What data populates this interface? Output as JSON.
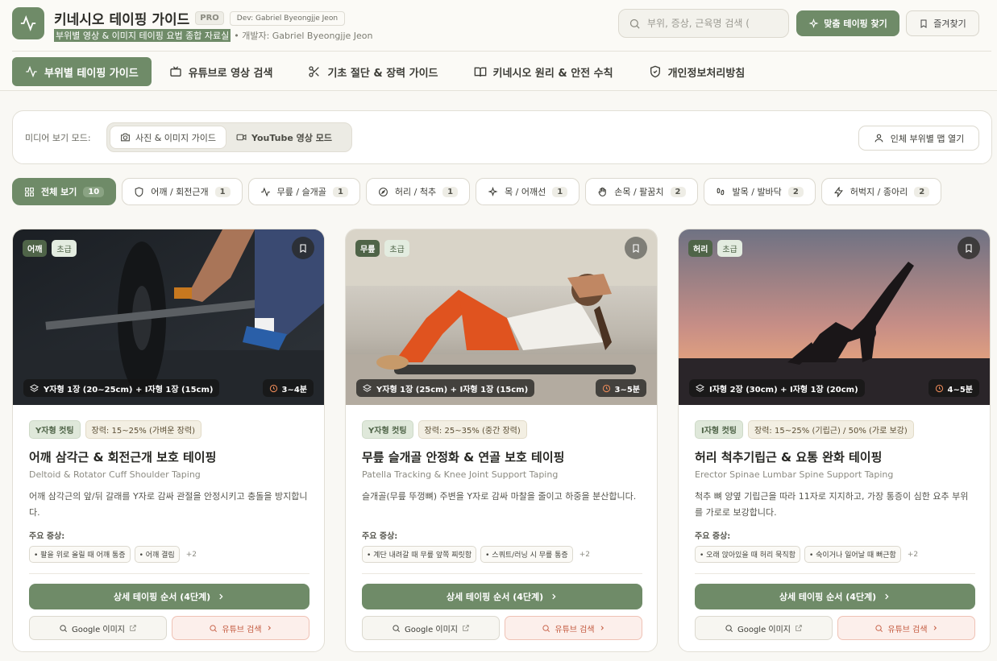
{
  "header": {
    "title": "키네시오 테이핑 가이드",
    "pro_badge": "PRO",
    "dev_badge": "Dev: Gabriel Byeongjje Jeon",
    "subtitle": "부위별 영상 & 이미지 테이핑 요법 종합 자료실",
    "subtitle_dev": "• 개발자: Gabriel Byeongjje Jeon",
    "search_placeholder": "부위, 증상, 근육명 검색 (",
    "find_button": "맞춤 테이핑 찾기",
    "fav_button": "즐겨찾기"
  },
  "nav": {
    "items": [
      {
        "label": "부위별 테이핑 가이드",
        "icon": "activity-icon"
      },
      {
        "label": "유튜브로 영상 검색",
        "icon": "tv-icon"
      },
      {
        "label": "기초 절단 & 장력 가이드",
        "icon": "scissors-icon"
      },
      {
        "label": "키네시오 원리 & 안전 수칙",
        "icon": "book-icon"
      },
      {
        "label": "개인정보처리방침",
        "icon": "shield-icon"
      }
    ]
  },
  "media": {
    "label": "미디어 보기 모드:",
    "photo_mode": "사진 & 이미지 가이드",
    "video_mode": "YouTube 영상 모드",
    "map_button": "인체 부위별 맵 열기"
  },
  "filters": [
    {
      "label": "전체 보기",
      "count": "10"
    },
    {
      "label": "어깨 / 회전근개",
      "count": "1"
    },
    {
      "label": "무릎 / 슬개골",
      "count": "1"
    },
    {
      "label": "허리 / 척추",
      "count": "1"
    },
    {
      "label": "목 / 어깨선",
      "count": "1"
    },
    {
      "label": "손목 / 팔꿈치",
      "count": "2"
    },
    {
      "label": "발목 / 발바닥",
      "count": "2"
    },
    {
      "label": "허벅지 / 종아리",
      "count": "2"
    }
  ],
  "cards": [
    {
      "area": "어깨",
      "level": "초급",
      "spec": "Y자형 1장 (20~25cm) + I자형 1장 (15cm)",
      "time": "3~4분",
      "cut": "Y자형 컷팅",
      "tension": "장력: 15~25% (가벼운 장력)",
      "title": "어깨 삼각근 & 회전근개 보호 테이핑",
      "title_en": "Deltoid & Rotator Cuff Shoulder Taping",
      "desc": "어깨 삼각근의 앞/뒤 갈래를 Y자로 감싸 관절을 안정시키고 충돌을 방지합니다.",
      "symptoms_label": "주요 증상:",
      "symptoms": [
        "• 팔을 위로 올릴 때 어깨 통증",
        "• 어깨 결림"
      ],
      "more": "+2",
      "detail_button": "상세 테이핑 순서 (4단계)",
      "google_button": "Google 이미지",
      "youtube_button": "유튜브 검색"
    },
    {
      "area": "무릎",
      "level": "초급",
      "spec": "Y자형 1장 (25cm) + I자형 1장 (15cm)",
      "time": "3~5분",
      "cut": "Y자형 컷팅",
      "tension": "장력: 25~35% (중간 장력)",
      "title": "무릎 슬개골 안정화 & 연골 보호 테이핑",
      "title_en": "Patella Tracking & Knee Joint Support Taping",
      "desc": "슬개골(무릎 뚜껑뼈) 주변을 Y자로 감싸 마찰을 줄이고 하중을 분산합니다.",
      "symptoms_label": "주요 증상:",
      "symptoms": [
        "• 계단 내려갈 때 무릎 앞쪽 찌릿함",
        "• 스쿼트/러닝 시 무릎 통증"
      ],
      "more": "+2",
      "detail_button": "상세 테이핑 순서 (4단계)",
      "google_button": "Google 이미지",
      "youtube_button": "유튜브 검색"
    },
    {
      "area": "허리",
      "level": "초급",
      "spec": "I자형 2장 (30cm) + I자형 1장 (20cm)",
      "time": "4~5분",
      "cut": "I자형 컷팅",
      "tension": "장력: 15~25% (기립근) / 50% (가로 보강)",
      "title": "허리 척추기립근 & 요통 완화 테이핑",
      "title_en": "Erector Spinae Lumbar Spine Support Taping",
      "desc": "척추 뼈 양옆 기립근을 따라 11자로 지지하고, 가장 통증이 심한 요추 부위를 가로로 보강합니다.",
      "symptoms_label": "주요 증상:",
      "symptoms": [
        "• 오래 앉아있을 때 허리 묵직함",
        "• 숙이거나 일어날 때 뻐근함"
      ],
      "more": "+2",
      "detail_button": "상세 테이핑 순서 (4단계)",
      "google_button": "Google 이미지",
      "youtube_button": "유튜브 검색"
    }
  ],
  "colors": {
    "accent": "#6f8b68",
    "background": "#f9f8f4",
    "youtube": "#c45a3f"
  }
}
